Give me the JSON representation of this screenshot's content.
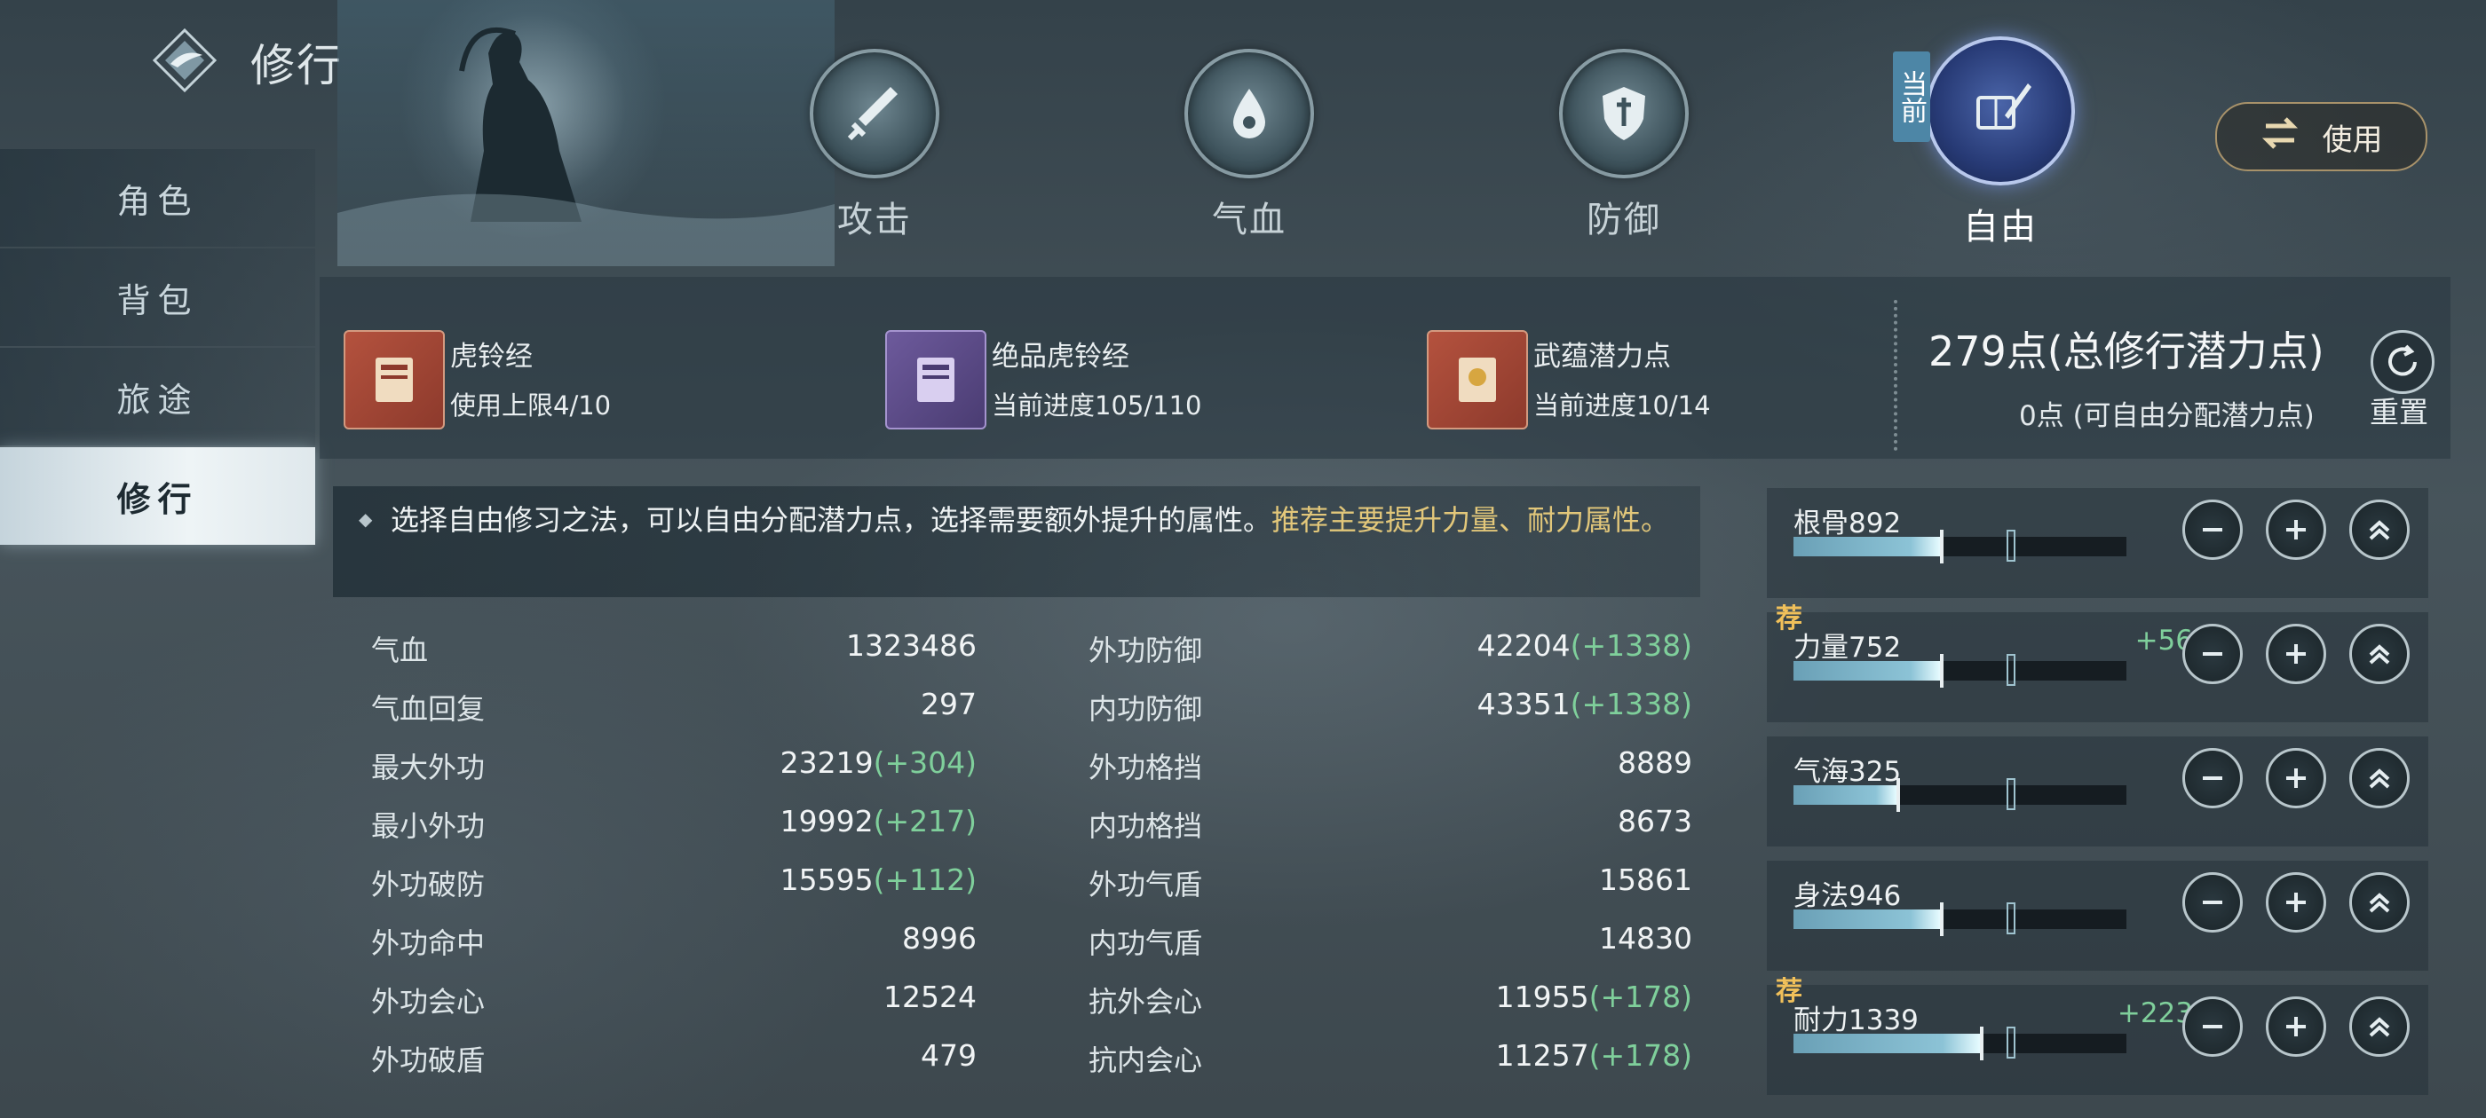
{
  "header": {
    "title": "修行"
  },
  "sidebar": {
    "items": [
      {
        "label": "角色"
      },
      {
        "label": "背包"
      },
      {
        "label": "旅途"
      },
      {
        "label": "修行"
      }
    ],
    "active_index": 3
  },
  "skills": [
    {
      "label": "攻击",
      "icon": "sword-icon"
    },
    {
      "label": "气血",
      "icon": "blood-drop-icon"
    },
    {
      "label": "防御",
      "icon": "shield-icon"
    },
    {
      "label": "自由",
      "icon": "book-quill-icon"
    }
  ],
  "current_badge": "当前",
  "use_button": {
    "label": "使用",
    "icon": "swap-arrows-icon"
  },
  "resources": [
    {
      "name": "虎铃经",
      "sub": "使用上限4/10"
    },
    {
      "name": "绝品虎铃经",
      "sub": "当前进度105/110"
    },
    {
      "name": "武蕴潜力点",
      "sub": "当前进度10/14"
    }
  ],
  "points": {
    "total": "279点(总修行潜力点)",
    "free": "0点 (可自由分配潜力点)",
    "reset_label": "重置"
  },
  "hint": {
    "text": "选择自由修习之法，可以自由分配潜力点，选择需要额外提升的属性。",
    "highlight": "推荐主要提升力量、耐力属性。"
  },
  "stats_left": [
    {
      "label": "气血",
      "value": "1323486",
      "bonus": ""
    },
    {
      "label": "气血回复",
      "value": "297",
      "bonus": ""
    },
    {
      "label": "最大外功",
      "value": "23219",
      "bonus": "(+304)"
    },
    {
      "label": "最小外功",
      "value": "19992",
      "bonus": "(+217)"
    },
    {
      "label": "外功破防",
      "value": "15595",
      "bonus": "(+112)"
    },
    {
      "label": "外功命中",
      "value": "8996",
      "bonus": ""
    },
    {
      "label": "外功会心",
      "value": "12524",
      "bonus": ""
    },
    {
      "label": "外功破盾",
      "value": "479",
      "bonus": ""
    }
  ],
  "stats_right": [
    {
      "label": "外功防御",
      "value": "42204",
      "bonus": "(+1338)"
    },
    {
      "label": "内功防御",
      "value": "43351",
      "bonus": "(+1338)"
    },
    {
      "label": "外功格挡",
      "value": "8889",
      "bonus": ""
    },
    {
      "label": "内功格挡",
      "value": "8673",
      "bonus": ""
    },
    {
      "label": "外功气盾",
      "value": "15861",
      "bonus": ""
    },
    {
      "label": "内功气盾",
      "value": "14830",
      "bonus": ""
    },
    {
      "label": "抗外会心",
      "value": "11955",
      "bonus": "(+178)"
    },
    {
      "label": "抗内会心",
      "value": "11257",
      "bonus": "(+178)"
    }
  ],
  "attributes": [
    {
      "name": "根骨892",
      "plus": "",
      "recommended": false,
      "fill_fraction": 0.44,
      "cap_fraction": 0.56
    },
    {
      "name": "力量752",
      "plus": "+56",
      "recommended": true,
      "fill_fraction": 0.44,
      "cap_fraction": 0.56
    },
    {
      "name": "气海325",
      "plus": "",
      "recommended": false,
      "fill_fraction": 0.31,
      "cap_fraction": 0.56
    },
    {
      "name": "身法946",
      "plus": "",
      "recommended": false,
      "fill_fraction": 0.44,
      "cap_fraction": 0.56
    },
    {
      "name": "耐力1339",
      "plus": "+223",
      "recommended": true,
      "fill_fraction": 0.56,
      "cap_fraction": 0.56
    }
  ],
  "recommend_badge": "荐",
  "colors": {
    "bonus_green": "#7fcf9b",
    "highlight_gold": "#e2c77a",
    "active_skill_blue": "#273a75"
  }
}
